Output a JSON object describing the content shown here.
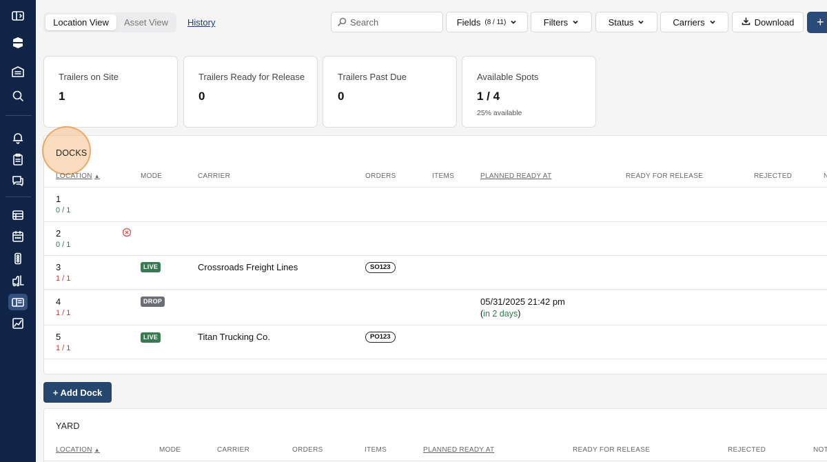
{
  "sidebar": {
    "icons": [
      "sidebar-toggle-icon",
      "logo-icon",
      "warehouse-icon",
      "search-icon",
      "bell-icon",
      "clipboard-icon",
      "chat-icon",
      "list-icon",
      "calendar-icon",
      "traffic-light-icon",
      "forklift-icon",
      "yard-map-icon",
      "chart-icon"
    ],
    "active": "yard-map-icon"
  },
  "header": {
    "views": {
      "location": "Location View",
      "asset": "Asset View"
    },
    "history": "History",
    "search_placeholder": "Search",
    "fields_label": "Fields",
    "fields_count": "(8 / 11)",
    "filters": "Filters",
    "status": "Status",
    "carriers": "Carriers",
    "download": "Download",
    "plus": "+"
  },
  "stats": [
    {
      "label": "Trailers on Site",
      "value": "1",
      "sub": ""
    },
    {
      "label": "Trailers Ready for Release",
      "value": "0",
      "sub": ""
    },
    {
      "label": "Trailers Past Due",
      "value": "0",
      "sub": ""
    },
    {
      "label": "Available Spots",
      "value": "1 / 4",
      "sub": "25% available"
    }
  ],
  "docks": {
    "title": "DOCKS",
    "columns": [
      "LOCATION",
      "MODE",
      "CARRIER",
      "ORDERS",
      "ITEMS",
      "PLANNED READY AT",
      "READY FOR RELEASE",
      "REJECTED",
      "N"
    ],
    "rows": [
      {
        "location": "1",
        "occupancy": "0 / 1",
        "mode": "",
        "carrier": "",
        "order": "",
        "planned": "",
        "relative": ""
      },
      {
        "location": "2",
        "occupancy": "0 / 1",
        "mode": "",
        "carrier": "",
        "order": "",
        "planned": "",
        "relative": ""
      },
      {
        "location": "3",
        "occupancy": "1 / 1",
        "mode": "LIVE",
        "carrier": "Crossroads Freight Lines",
        "order": "SO123",
        "planned": "",
        "relative": ""
      },
      {
        "location": "4",
        "occupancy": "1 / 1",
        "mode": "DROP",
        "carrier": "",
        "order": "",
        "planned": "05/31/2025 21:42 pm",
        "relative": "in 2 days"
      },
      {
        "location": "5",
        "occupancy": "1 / 1",
        "mode": "LIVE",
        "carrier": "Titan Trucking Co.",
        "order": "PO123",
        "planned": "",
        "relative": ""
      }
    ]
  },
  "add_dock": "+ Add Dock",
  "yard": {
    "title": "YARD",
    "columns": [
      "LOCATION",
      "MODE",
      "CARRIER",
      "ORDERS",
      "ITEMS",
      "PLANNED READY AT",
      "READY FOR RELEASE",
      "REJECTED",
      "NOT"
    ]
  },
  "colors": {
    "sidebar": "#0f2447",
    "primary": "#24466f",
    "live": "#3a7a53",
    "drop": "#6b6e73",
    "free": "#2d7a4f",
    "full": "#c0392b"
  }
}
